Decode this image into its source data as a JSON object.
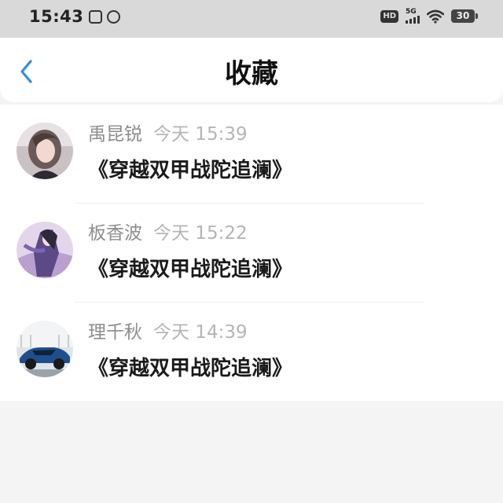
{
  "status_bar": {
    "time": "15:43",
    "network_label": "5G",
    "hd_label": "HD",
    "battery_level": "30",
    "icons": [
      "image-notification-icon",
      "app-notification-icon",
      "hd-icon",
      "signal-icon",
      "wifi-icon",
      "battery-icon"
    ]
  },
  "nav": {
    "back_icon": "chevron-left-icon",
    "title": "收藏"
  },
  "favorites": [
    {
      "author": "禹昆锐",
      "time": "今天 15:39",
      "content": "《穿越双甲战陀追澜》",
      "avatar": "woman-portrait"
    },
    {
      "author": "板香波",
      "time": "今天 15:22",
      "content": "《穿越双甲战陀追澜》",
      "avatar": "anime-character"
    },
    {
      "author": "理千秋",
      "time": "今天 14:39",
      "content": "《穿越双甲战陀追澜》",
      "avatar": "blue-sports-car"
    }
  ],
  "colors": {
    "accent": "#2f8fd8",
    "status_bar_bg": "#d9d9d9",
    "page_bg": "#f4f4f4"
  }
}
